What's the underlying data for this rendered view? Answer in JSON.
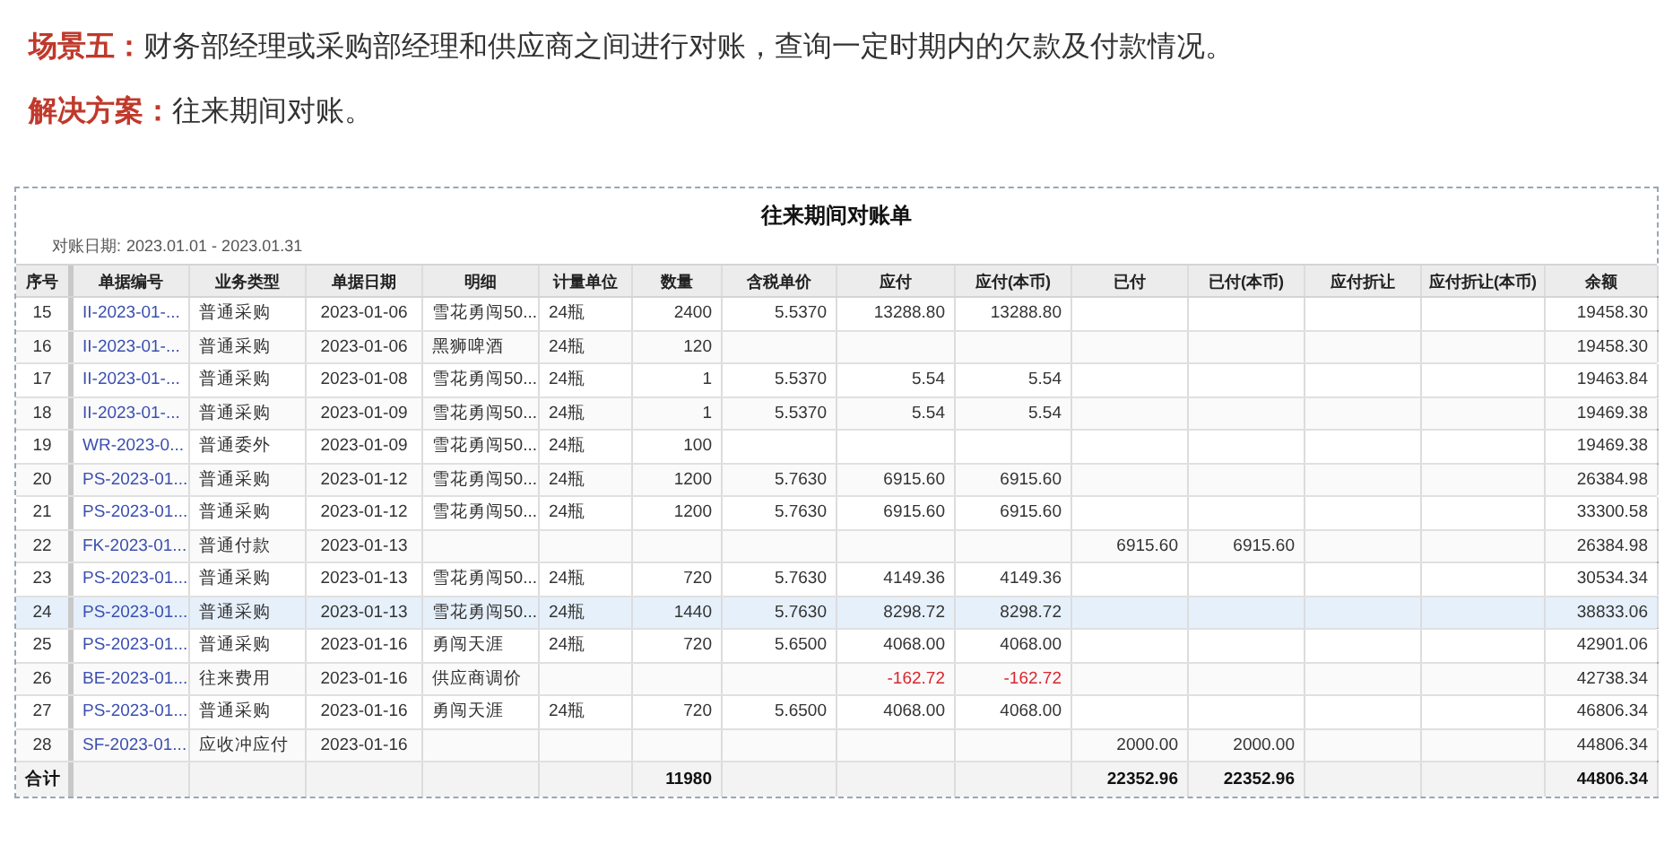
{
  "headings": [
    {
      "label": "场景五：",
      "text": "财务部经理或采购部经理和供应商之间进行对账，查询一定时期内的欠款及付款情况。"
    },
    {
      "label": "解决方案：",
      "text": "往来期间对账。"
    }
  ],
  "report": {
    "title": "往来期间对账单",
    "date_label": "对账日期:",
    "date_range": "2023.01.01 - 2023.01.31",
    "columns": [
      "序号",
      "单据编号",
      "业务类型",
      "单据日期",
      "明细",
      "计量单位",
      "数量",
      "含税单价",
      "应付",
      "应付(本币)",
      "已付",
      "已付(本币)",
      "应付折让",
      "应付折让(本币)",
      "余额"
    ],
    "rows": [
      {
        "no": "15",
        "doc": "II-2023-01-...",
        "type": "普通采购",
        "date": "2023-01-06",
        "detail": "雪花勇闯50...",
        "unit": "24瓶",
        "qty": "2400",
        "price": "5.5370",
        "payable": "13288.80",
        "payable_local": "13288.80",
        "balance": "19458.30",
        "selected": false,
        "negative": false
      },
      {
        "no": "16",
        "doc": "II-2023-01-...",
        "type": "普通采购",
        "date": "2023-01-06",
        "detail": "黑狮啤酒",
        "unit": "24瓶",
        "qty": "120",
        "balance": "19458.30",
        "selected": false,
        "negative": false
      },
      {
        "no": "17",
        "doc": "II-2023-01-...",
        "type": "普通采购",
        "date": "2023-01-08",
        "detail": "雪花勇闯50...",
        "unit": "24瓶",
        "qty": "1",
        "price": "5.5370",
        "payable": "5.54",
        "payable_local": "5.54",
        "balance": "19463.84",
        "selected": false,
        "negative": false
      },
      {
        "no": "18",
        "doc": "II-2023-01-...",
        "type": "普通采购",
        "date": "2023-01-09",
        "detail": "雪花勇闯50...",
        "unit": "24瓶",
        "qty": "1",
        "price": "5.5370",
        "payable": "5.54",
        "payable_local": "5.54",
        "balance": "19469.38",
        "selected": false,
        "negative": false
      },
      {
        "no": "19",
        "doc": "WR-2023-0...",
        "type": "普通委外",
        "date": "2023-01-09",
        "detail": "雪花勇闯50...",
        "unit": "24瓶",
        "qty": "100",
        "balance": "19469.38",
        "selected": false,
        "negative": false
      },
      {
        "no": "20",
        "doc": "PS-2023-01...",
        "type": "普通采购",
        "date": "2023-01-12",
        "detail": "雪花勇闯50...",
        "unit": "24瓶",
        "qty": "1200",
        "price": "5.7630",
        "payable": "6915.60",
        "payable_local": "6915.60",
        "balance": "26384.98",
        "selected": false,
        "negative": false
      },
      {
        "no": "21",
        "doc": "PS-2023-01...",
        "type": "普通采购",
        "date": "2023-01-12",
        "detail": "雪花勇闯50...",
        "unit": "24瓶",
        "qty": "1200",
        "price": "5.7630",
        "payable": "6915.60",
        "payable_local": "6915.60",
        "balance": "33300.58",
        "selected": false,
        "negative": false
      },
      {
        "no": "22",
        "doc": "FK-2023-01...",
        "type": "普通付款",
        "date": "2023-01-13",
        "paid": "6915.60",
        "paid_local": "6915.60",
        "balance": "26384.98",
        "selected": false,
        "negative": false
      },
      {
        "no": "23",
        "doc": "PS-2023-01...",
        "type": "普通采购",
        "date": "2023-01-13",
        "detail": "雪花勇闯50...",
        "unit": "24瓶",
        "qty": "720",
        "price": "5.7630",
        "payable": "4149.36",
        "payable_local": "4149.36",
        "balance": "30534.34",
        "selected": false,
        "negative": false
      },
      {
        "no": "24",
        "doc": "PS-2023-01...",
        "type": "普通采购",
        "date": "2023-01-13",
        "detail": "雪花勇闯50...",
        "unit": "24瓶",
        "qty": "1440",
        "price": "5.7630",
        "payable": "8298.72",
        "payable_local": "8298.72",
        "balance": "38833.06",
        "selected": true,
        "negative": false
      },
      {
        "no": "25",
        "doc": "PS-2023-01...",
        "type": "普通采购",
        "date": "2023-01-16",
        "detail": "勇闯天涯",
        "unit": "24瓶",
        "qty": "720",
        "price": "5.6500",
        "payable": "4068.00",
        "payable_local": "4068.00",
        "balance": "42901.06",
        "selected": false,
        "negative": false
      },
      {
        "no": "26",
        "doc": "BE-2023-01...",
        "type": "往来费用",
        "date": "2023-01-16",
        "detail": "供应商调价",
        "payable": "-162.72",
        "payable_local": "-162.72",
        "balance": "42738.34",
        "selected": false,
        "negative": true
      },
      {
        "no": "27",
        "doc": "PS-2023-01...",
        "type": "普通采购",
        "date": "2023-01-16",
        "detail": "勇闯天涯",
        "unit": "24瓶",
        "qty": "720",
        "price": "5.6500",
        "payable": "4068.00",
        "payable_local": "4068.00",
        "balance": "46806.34",
        "selected": false,
        "negative": false
      },
      {
        "no": "28",
        "doc": "SF-2023-01...",
        "type": "应收冲应付",
        "date": "2023-01-16",
        "paid": "2000.00",
        "paid_local": "2000.00",
        "balance": "44806.34",
        "selected": false,
        "negative": false
      }
    ],
    "total": {
      "label": "合计",
      "qty": "11980",
      "paid": "22352.96",
      "paid_local": "22352.96",
      "balance": "44806.34"
    }
  }
}
